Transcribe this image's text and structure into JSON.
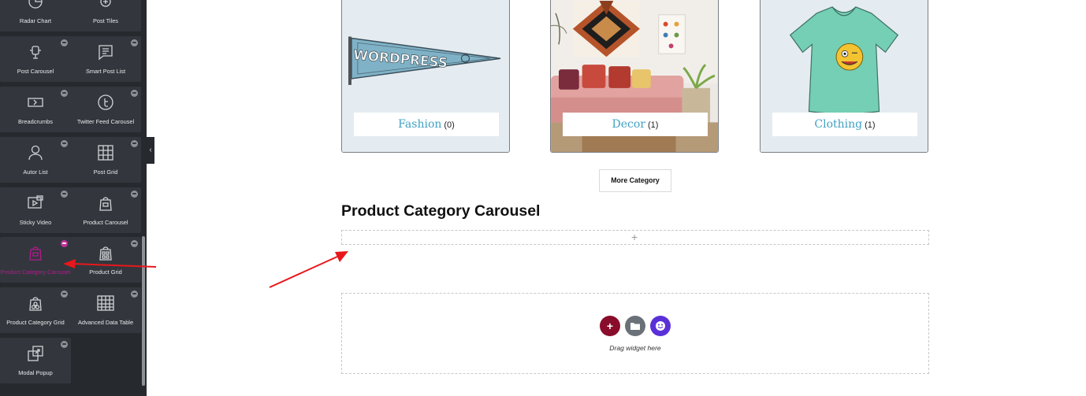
{
  "sidebar": {
    "widgets": [
      {
        "label": "Radar Chart",
        "icon": "radar-chart-icon"
      },
      {
        "label": "Post Tiles",
        "icon": "post-tiles-icon"
      },
      {
        "label": "Post Carousel",
        "icon": "post-carousel-icon"
      },
      {
        "label": "Smart Post List",
        "icon": "smart-post-list-icon"
      },
      {
        "label": "Breadcrumbs",
        "icon": "breadcrumbs-icon"
      },
      {
        "label": "Twitter Feed Carousel",
        "icon": "twitter-icon"
      },
      {
        "label": "Autor List",
        "icon": "author-list-icon"
      },
      {
        "label": "Post Grid",
        "icon": "post-grid-icon"
      },
      {
        "label": "Sticky Video",
        "icon": "sticky-video-icon"
      },
      {
        "label": "Product Carousel",
        "icon": "product-carousel-icon"
      },
      {
        "label": "Product Category Carousel",
        "icon": "product-category-carousel-icon",
        "active": true
      },
      {
        "label": "Product Grid",
        "icon": "product-grid-icon"
      },
      {
        "label": "Product Category Grid",
        "icon": "product-category-grid-icon"
      },
      {
        "label": "Advanced Data Table",
        "icon": "data-table-icon"
      },
      {
        "label": "Modal Popup",
        "icon": "modal-popup-icon"
      }
    ],
    "collapse_glyph": "‹"
  },
  "categories": [
    {
      "name": "Fashion",
      "count": "(0)",
      "image": "wordpress-pennant"
    },
    {
      "name": "Decor",
      "count": "(1)",
      "image": "living-room-decor"
    },
    {
      "name": "Clothing",
      "count": "(1)",
      "image": "green-tshirt"
    }
  ],
  "pennant_text": "WORDPRESS",
  "more_category_label": "More Category",
  "section_title": "Product Category Carousel",
  "empty_row_plus": "+",
  "dropzone": {
    "add_glyph": "+",
    "text": "Drag widget here"
  },
  "colors": {
    "sidebar_bg": "#262a2f",
    "tile_bg": "#33373d",
    "active_pink": "#b21a8e",
    "category_link": "#3fa1c3",
    "arrow_red": "#e8171b",
    "add_button": "#8a0c2b",
    "ha_button": "#5a30d8"
  }
}
